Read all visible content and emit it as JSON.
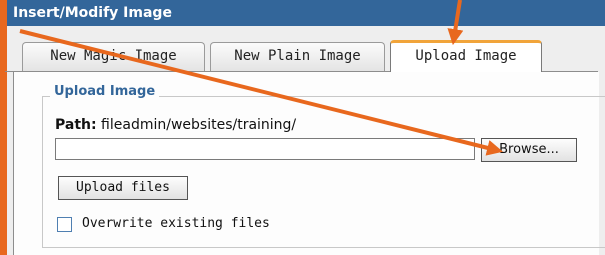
{
  "window": {
    "title": "Insert/Modify Image"
  },
  "tabs": [
    {
      "label": "New Magic Image",
      "active": false
    },
    {
      "label": "New Plain Image",
      "active": false
    },
    {
      "label": "Upload Image",
      "active": true
    }
  ],
  "upload_section": {
    "legend": "Upload Image",
    "path_label": "Path:",
    "path_value": "fileadmin/websites/training/",
    "path_input_value": "",
    "browse_label": "Browse...",
    "upload_label": "Upload files",
    "overwrite_label": "Overwrite existing files",
    "overwrite_checked": false
  },
  "colors": {
    "title_bar": "#33669a",
    "annotation": "#e8681e",
    "active_tab_accent": "#f1a43a",
    "legend_text": "#33669a"
  }
}
